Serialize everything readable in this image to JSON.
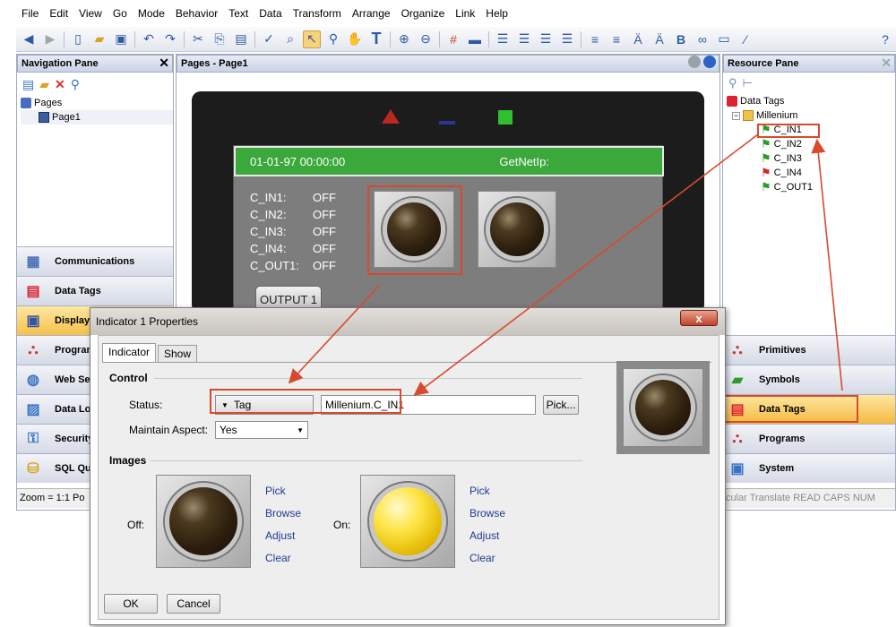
{
  "menu": [
    "File",
    "Edit",
    "View",
    "Go",
    "Mode",
    "Behavior",
    "Text",
    "Data",
    "Transform",
    "Arrange",
    "Organize",
    "Link",
    "Help"
  ],
  "toolbar": {
    "icons": [
      "back-icon",
      "forward-icon",
      "new-icon",
      "open-icon",
      "save-icon",
      "undo-icon",
      "redo-icon",
      "cut-icon",
      "copy-icon",
      "paste-icon",
      "spell-icon",
      "find-icon",
      "select-icon",
      "zoom-icon",
      "pan-icon",
      "text-icon",
      "zoom-in-icon",
      "zoom-out-icon",
      "grid-icon",
      "flag-icon",
      "align-icon",
      "help-icon"
    ]
  },
  "nav_pane": {
    "title": "Navigation Pane",
    "tree": [
      {
        "label": "Pages"
      },
      {
        "label": "Page1"
      }
    ],
    "buttons": [
      "Communications",
      "Data Tags",
      "Display",
      "Programs",
      "Web Server",
      "Data Logging",
      "Security",
      "SQL Queries"
    ],
    "zoom": "Zoom = 1:1  Po"
  },
  "pages_pane": {
    "title": "Pages - Page1",
    "screen": {
      "date": "01-01-97 00:00:00",
      "netip": "GetNetIp:",
      "rows": [
        {
          "tag": "C_IN1:",
          "state": "OFF"
        },
        {
          "tag": "C_IN2:",
          "state": "OFF"
        },
        {
          "tag": "C_IN3:",
          "state": "OFF"
        },
        {
          "tag": "C_IN4:",
          "state": "OFF"
        },
        {
          "tag": "C_OUT1:",
          "state": "OFF"
        }
      ],
      "output_btn": "OUTPUT 1"
    }
  },
  "resource_pane": {
    "title": "Resource Pane",
    "tree_root": "Data Tags",
    "folder": "Millenium",
    "tags": [
      "C_IN1",
      "C_IN2",
      "C_IN3",
      "C_IN4",
      "C_OUT1"
    ],
    "buttons": [
      "Primitives",
      "Symbols",
      "Data Tags",
      "Programs",
      "System"
    ],
    "status": "cular Translate READ CAPS NUM"
  },
  "dialog": {
    "title": "Indicator 1 Properties",
    "close": "x",
    "tabs": [
      "Indicator",
      "Show"
    ],
    "control_label": "Control",
    "status_label": "Status:",
    "status_type": "Tag",
    "status_value": "Millenium.C_IN1",
    "pick_label": "Pick...",
    "aspect_label": "Maintain Aspect:",
    "aspect_value": "Yes",
    "images_label": "Images",
    "off_label": "Off:",
    "on_label": "On:",
    "image_links": [
      "Pick",
      "Browse",
      "Adjust",
      "Clear"
    ],
    "ok": "OK",
    "cancel": "Cancel"
  },
  "colors": {
    "highlight": "#d84a2e",
    "accent": "#3aa83a"
  }
}
